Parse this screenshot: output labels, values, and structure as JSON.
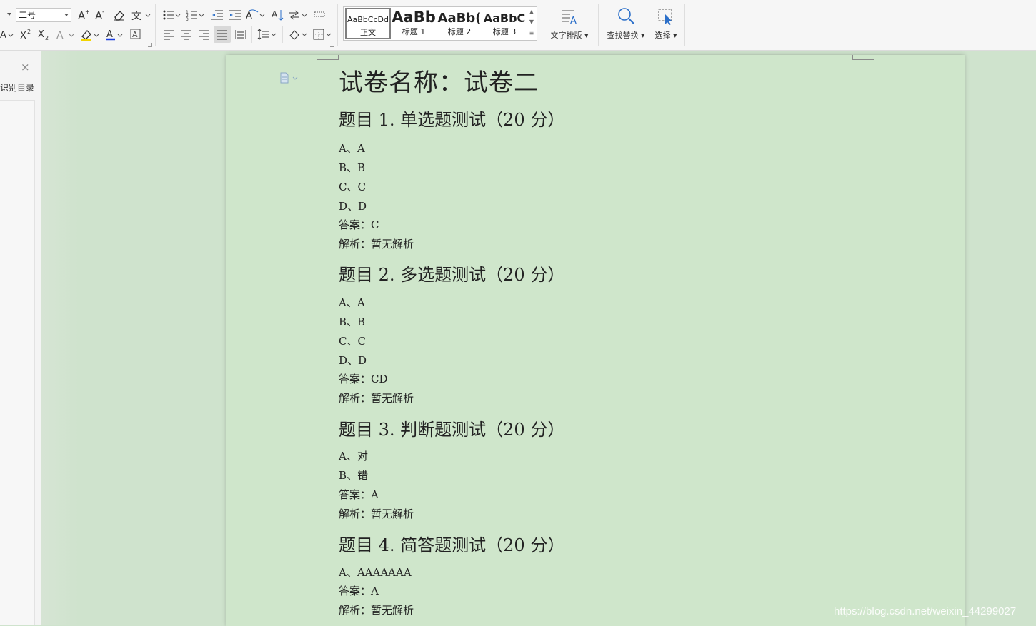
{
  "toolbar": {
    "font_size_value": "二号",
    "styles": [
      {
        "preview": "AaBbCcDd",
        "name": "正文",
        "selected": true
      },
      {
        "preview": "AaBb",
        "name": "标题 1"
      },
      {
        "preview": "AaBb(",
        "name": "标题 2"
      },
      {
        "preview": "AaBbC",
        "name": "标题 3"
      }
    ],
    "text_layout_label": "文字排版",
    "find_replace_label": "查找替换",
    "select_label": "选择",
    "icons": [
      "grow-font-icon",
      "shrink-font-icon",
      "clear-format-icon",
      "phonetic-guide-icon",
      "bullets-icon",
      "numbering-icon",
      "decrease-indent-icon",
      "increase-indent-icon",
      "chinese-layout-icon",
      "sort-icon",
      "text-direction-icon",
      "show-marks-icon",
      "superscript-icon",
      "subscript-icon",
      "text-effects-icon",
      "highlight-icon",
      "font-color-icon",
      "char-border-icon",
      "align-left-icon",
      "align-center-icon",
      "align-right-icon",
      "justify-icon",
      "distribute-icon",
      "line-spacing-icon",
      "shading-icon",
      "borders-icon",
      "search-icon",
      "select-cursor-icon"
    ]
  },
  "nav": {
    "title": "识别目录",
    "close": "×"
  },
  "document": {
    "title": "试卷名称：试卷二",
    "lines": [
      {
        "type": "heading",
        "text": "题目 1. 单选题测试（20 分）"
      },
      {
        "type": "item",
        "text": "A、A"
      },
      {
        "type": "item",
        "text": "B、B"
      },
      {
        "type": "item",
        "text": "C、C"
      },
      {
        "type": "item",
        "text": "D、D"
      },
      {
        "type": "item",
        "text": "答案：C"
      },
      {
        "type": "item",
        "text": "解析：暂无解析"
      },
      {
        "type": "heading",
        "text": "题目 2. 多选题测试（20 分）"
      },
      {
        "type": "item",
        "text": "A、A"
      },
      {
        "type": "item",
        "text": "B、B"
      },
      {
        "type": "item",
        "text": "C、C"
      },
      {
        "type": "item",
        "text": "D、D"
      },
      {
        "type": "item",
        "text": "答案：CD"
      },
      {
        "type": "item",
        "text": "解析：暂无解析"
      },
      {
        "type": "heading",
        "text": "题目 3. 判断题测试（20 分）"
      },
      {
        "type": "item",
        "text": "A、对"
      },
      {
        "type": "item",
        "text": "B、错"
      },
      {
        "type": "item",
        "text": "答案：A"
      },
      {
        "type": "item",
        "text": "解析：暂无解析"
      },
      {
        "type": "heading",
        "text": "题目 4. 简答题测试（20 分）"
      },
      {
        "type": "item",
        "text": "A、AAAAAAA"
      },
      {
        "type": "item",
        "text": "答案：A"
      },
      {
        "type": "item",
        "text": "解析：暂无解析"
      }
    ]
  },
  "watermark": "https://blog.csdn.net/weixin_44299027",
  "colors": {
    "page": "#cfe6cb",
    "background": "#cfe3cd",
    "toolbar": "#f6f6f6",
    "accent": "#2b6fc9"
  }
}
